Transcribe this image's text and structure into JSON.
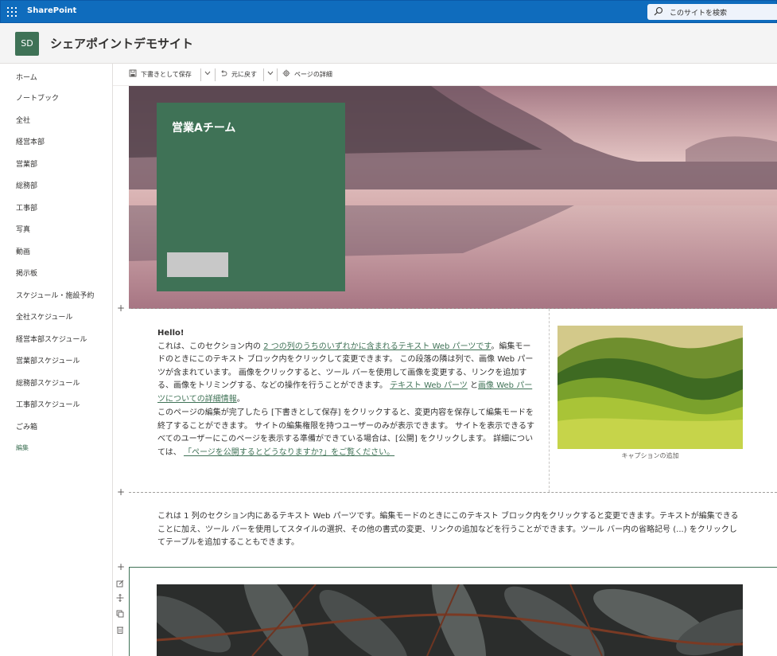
{
  "suite_bar": {
    "app_name": "SharePoint",
    "search_placeholder": "このサイトを検索",
    "accent_color": "#0f6cbd"
  },
  "site": {
    "logo_initials": "SD",
    "title": "シェアポイントデモサイト",
    "brand_color": "#3f7256"
  },
  "nav": {
    "items": [
      "ホーム",
      "ノートブック",
      "全社",
      "経営本部",
      "営業部",
      "総務部",
      "工事部",
      "写真",
      "動画",
      "掲示板",
      "スケジュール・施設予約",
      "全社スケジュール",
      "経営本部スケジュール",
      "営業部スケジュール",
      "総務部スケジュール",
      "工事部スケジュール",
      "ごみ箱"
    ],
    "edit_label": "編集"
  },
  "command_bar": {
    "save_label": "下書きとして保存",
    "undo_label": "元に戻す",
    "details_label": "ページの詳細"
  },
  "hero": {
    "title": "営業Aチーム"
  },
  "text_part": {
    "hello": "Hello!",
    "p1_a": "これは、このセクション内の ",
    "p1_link": "2 つの列のうちのいずれかに含まれるテキスト Web パーツです",
    "p1_b": "。編集モードのときにこのテキスト ブロック内をクリックして変更できます。 この段落の隣は列で、画像 Web パーツが含まれています。 画像をクリックすると、ツール バーを使用して画像を変更する、リンクを追加する、画像をトリミングする、などの操作を行うことができます。 ",
    "p1_link2": "テキスト Web パーツ",
    "p1_c": " と",
    "p1_link3": "画像 Web パーツについての詳細情報",
    "p1_d": "。",
    "p2_a": "このページの編集が完了したら [下書きとして保存] をクリックすると、変更内容を保存して編集モードを終了することができます。 サイトの編集権限を持つユーザーのみが表示できます。 サイトを表示できるすべてのユーザーにこのページを表示する準備ができている場合は、[公開] をクリックします。 詳細については、 ",
    "p2_link": "「ページを公開するとどうなりますか?」をご覧ください。"
  },
  "image_part": {
    "caption": "キャプションの追加"
  },
  "one_column_text": "これは 1 列のセクション内にあるテキスト Web パーツです。編集モードのときにこのテキスト ブロック内をクリックすると変更できます。テキストが編集できることに加え、ツール バーを使用してスタイルの選択、その他の書式の変更、リンクの追加などを行うことができます。ツール バー内の省略記号 (...) をクリックしてテーブルを追加することもできます。",
  "section_controls": {
    "add_symbol": "+"
  }
}
